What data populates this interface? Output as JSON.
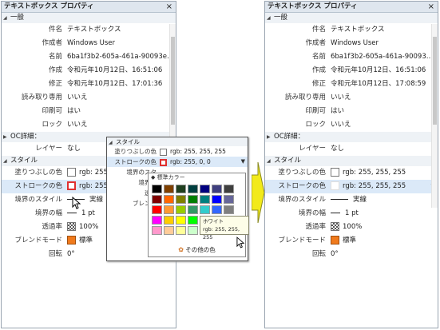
{
  "left": {
    "title": "テキストボックス プロパティ",
    "close": "×",
    "sections": {
      "general": "一般",
      "oc": "OC詳細：",
      "style": "スタイル"
    },
    "general_rows": [
      {
        "label": "件名",
        "value": "テキストボックス"
      },
      {
        "label": "作成者",
        "value": "Windows User"
      },
      {
        "label": "名前",
        "value": "6ba1f3b2-605a-461a-90093e8714..."
      },
      {
        "label": "作成",
        "value": "令和元年10月12日、16:51:06"
      },
      {
        "label": "修正",
        "value": "令和元年10月12日、17:01:36"
      },
      {
        "label": "読み取り専用",
        "value": "いいえ"
      },
      {
        "label": "印刷可",
        "value": "はい"
      },
      {
        "label": "ロック",
        "value": "いいえ"
      }
    ],
    "oc_rows": [
      {
        "label": "レイヤー",
        "value": "なし"
      }
    ],
    "style_rows": {
      "fill": {
        "label": "塗りつぶしの色",
        "value": "rgb: 255, 255, 255"
      },
      "stroke": {
        "label": "ストロークの色",
        "value": "rgb: 255, 0, 0"
      },
      "border_style": {
        "label": "境界のスタイル",
        "value": "実線"
      },
      "border_width": {
        "label": "境界の幅",
        "value": "1 pt"
      },
      "opacity": {
        "label": "透過率",
        "value": "100%"
      },
      "blend": {
        "label": "ブレンドモード",
        "value": "標準"
      },
      "rotation": {
        "label": "回転",
        "value": "0°"
      }
    }
  },
  "callout": {
    "section": "スタイル",
    "fill": {
      "label": "塗りつぶしの色",
      "value": "rgb: 255, 255, 255"
    },
    "stroke": {
      "label": "ストロークの色",
      "value": "rgb: 255, 0, 0"
    },
    "hidden_labels": [
      "境界のスタ",
      "境界の",
      "透過",
      "ブレンド",
      "回"
    ],
    "popup_head": "標準カラー",
    "more_colors": "その他の色",
    "tooltip_title": "ホワイト",
    "tooltip_value": "rgb: 255, 255, 255",
    "palette": [
      "#000000",
      "#7f3f00",
      "#1f3f1f",
      "#003f3f",
      "#00007f",
      "#3f3f7f",
      "#3f3f3f",
      "#7f0000",
      "#ff6600",
      "#7f7f00",
      "#007f00",
      "#007f7f",
      "#0000ff",
      "#666699",
      "#ff0000",
      "#ff9933",
      "#99cc00",
      "#339966",
      "#33cccc",
      "#3366ff",
      "#7f7f7f",
      "#ff00ff",
      "#ffcc00",
      "#ffff00",
      "#00ff00",
      "#00ffff",
      "#00ccff",
      "#999999",
      "#ff99cc",
      "#ffcc99",
      "#ffff99",
      "#ccffcc",
      "#ccffff",
      "#99ccff",
      "#ffffff"
    ]
  },
  "right": {
    "title": "テキストボックス プロパティ",
    "close": "×",
    "sections": {
      "general": "一般",
      "oc": "OC詳細：",
      "style": "スタイル"
    },
    "general_rows": [
      {
        "label": "件名",
        "value": "テキストボックス"
      },
      {
        "label": "作成者",
        "value": "Windows User"
      },
      {
        "label": "名前",
        "value": "6ba1f3b2-605a-461a-90093e8714..."
      },
      {
        "label": "作成",
        "value": "令和元年10月12日、16:51:06"
      },
      {
        "label": "修正",
        "value": "令和元年10月12日、17:08:59"
      },
      {
        "label": "読み取り専用",
        "value": "いいえ"
      },
      {
        "label": "印刷可",
        "value": "はい"
      },
      {
        "label": "ロック",
        "value": "いいえ"
      }
    ],
    "oc_rows": [
      {
        "label": "レイヤー",
        "value": "なし"
      }
    ],
    "style_rows": {
      "fill": {
        "label": "塗りつぶしの色",
        "value": "rgb: 255, 255, 255"
      },
      "stroke": {
        "label": "ストロークの色",
        "value": "rgb: 255, 255, 255"
      },
      "border_style": {
        "label": "境界のスタイル",
        "value": "実線"
      },
      "border_width": {
        "label": "境界の幅",
        "value": "1 pt"
      },
      "opacity": {
        "label": "透過率",
        "value": "100%"
      },
      "blend": {
        "label": "ブレンドモード",
        "value": "標準"
      },
      "rotation": {
        "label": "回転",
        "value": "0°"
      }
    }
  },
  "colors": {
    "arrow_fill": "#f2ea1a",
    "stroke_red": "#e03030",
    "blend_orange": "#f07a1c",
    "highlight": "#dbe9f8"
  }
}
